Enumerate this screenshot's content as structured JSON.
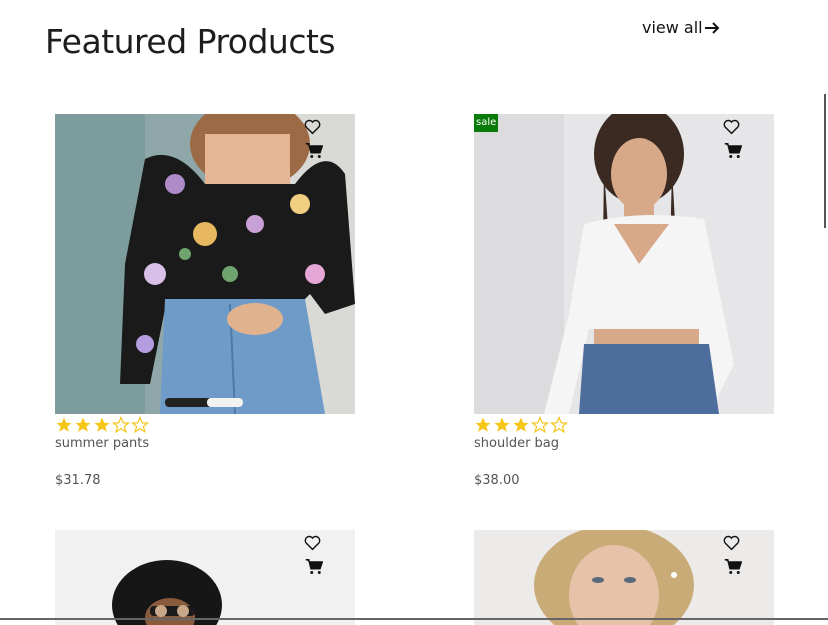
{
  "header": {
    "title": "Featured Products",
    "view_all": "view all"
  },
  "products": [
    {
      "name": "summer pants",
      "price": "$31.78",
      "rating": 3,
      "max_rating": 5,
      "sale_badge": "",
      "image": "floral long-sleeve top photo"
    },
    {
      "name": "shoulder bag",
      "price": "$38.00",
      "rating": 3,
      "max_rating": 5,
      "sale_badge": "sale",
      "image": "white wrap crop top photo"
    },
    {
      "name": "",
      "price": "",
      "image": "curly hair model with glasses photo"
    },
    {
      "name": "",
      "price": "",
      "image": "blonde model photo"
    }
  ],
  "colors": {
    "star": "#f5c518",
    "sale_badge": "#0a7a0a"
  },
  "icons": [
    "heart-icon",
    "cart-icon",
    "arrow-right-icon",
    "star-icon"
  ]
}
